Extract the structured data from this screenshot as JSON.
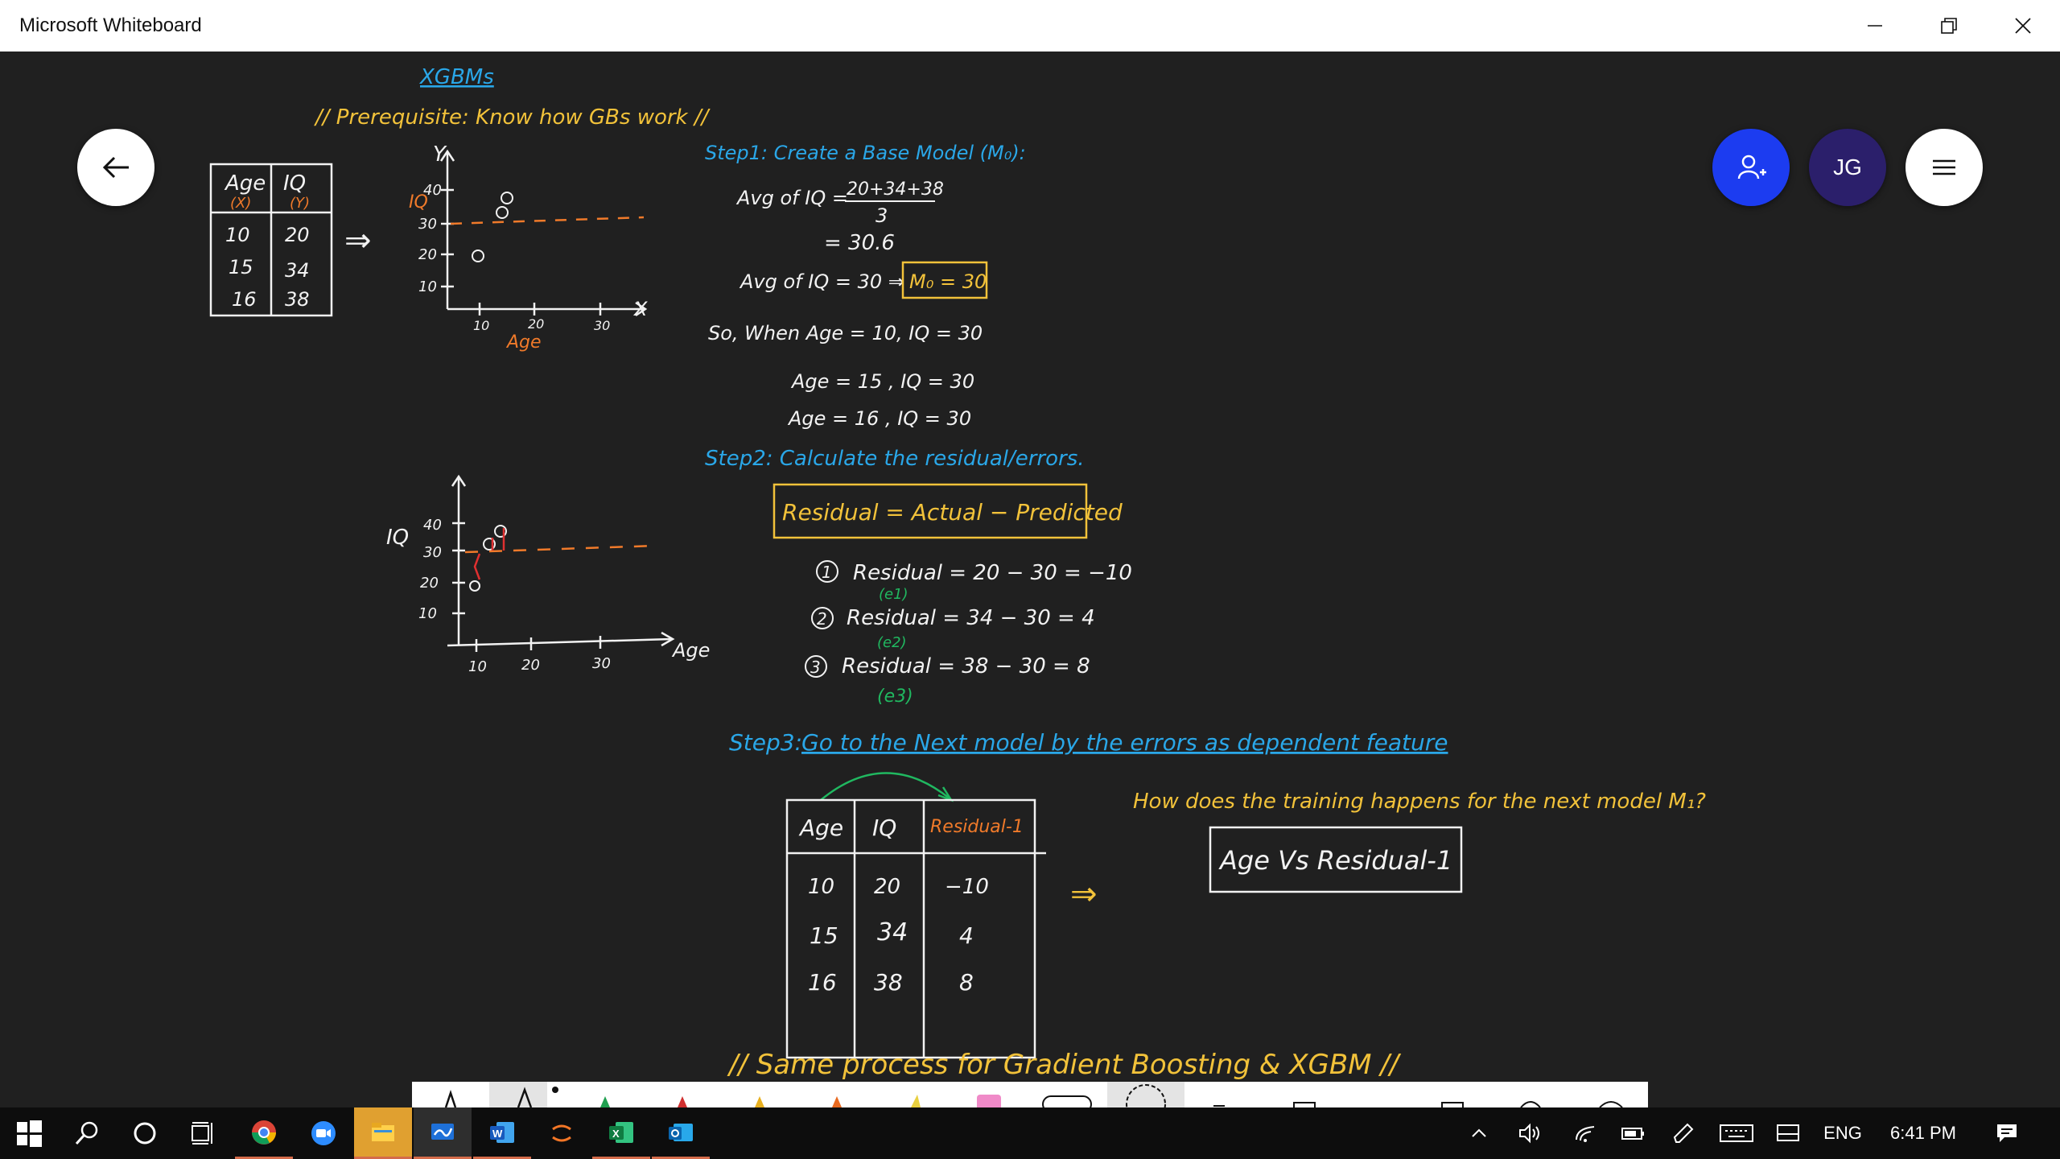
{
  "window": {
    "title": "Microsoft Whiteboard",
    "controls": [
      "minimize-icon",
      "restore-icon",
      "close-icon"
    ]
  },
  "canvas": {
    "heading": "XGBMs",
    "prerequisite": "// Prerequisite: Know how GBs work //",
    "table1": {
      "headers": [
        "Age",
        "IQ"
      ],
      "subheaders": [
        "(X)",
        "(Y)"
      ],
      "rows": [
        [
          "10",
          "20"
        ],
        [
          "15",
          "34"
        ],
        [
          "16",
          "38"
        ]
      ]
    },
    "arrow": "⇒",
    "plot1": {
      "ylabel": "IQ",
      "yaxis": "Y",
      "xaxis": "X",
      "xlabel": "Age",
      "yticks": [
        "40",
        "30",
        "20",
        "10"
      ],
      "xticks": [
        "10",
        "20",
        "30"
      ]
    },
    "plot2": {
      "ylabel": "IQ",
      "xlabel": "Age",
      "yticks": [
        "40",
        "30",
        "20",
        "10"
      ],
      "xticks": [
        "10",
        "20",
        "30"
      ]
    },
    "step1": {
      "title": "Step1: Create a Base Model (M₀):",
      "line1": "Avg of IQ =",
      "fraction_num": "20+34+38",
      "fraction_den": "3",
      "line2": "= 30.6",
      "line3": "Avg of IQ = 30 ⇒",
      "boxed": "M₀ = 30",
      "line4": "So, When Age = 10, IQ = 30",
      "line5": "Age = 15 , IQ = 30",
      "line6": "Age = 16 , IQ = 30"
    },
    "step2": {
      "title": "Step2: Calculate the residual/errors.",
      "formula": "Residual = Actual − Predicted",
      "rows": [
        {
          "num": "1",
          "expr": "Residual = 20 − 30 = −10",
          "tag": "(e1)"
        },
        {
          "num": "2",
          "expr": "Residual = 34 − 30 = 4",
          "tag": "(e2)"
        },
        {
          "num": "3",
          "expr": "Residual = 38 − 30 = 8",
          "tag": "(e3)"
        }
      ]
    },
    "step3": {
      "label": "Step3:",
      "text": "Go to the Next model by the errors as dependent feature"
    },
    "table2": {
      "headers": [
        "Age",
        "IQ",
        "Residual-1"
      ],
      "rows": [
        [
          "10",
          "20",
          "−10"
        ],
        [
          "15",
          "34",
          "4"
        ],
        [
          "16",
          "38",
          "8"
        ]
      ]
    },
    "question": "How does the training happens for the next model M₁?",
    "answer_box": "Age Vs Residual-1",
    "footer_note": "// Same process for Gradient Boosting & XGBM //"
  },
  "buttons": {
    "back": "back-arrow-icon",
    "invite": "add-person-icon",
    "avatar": "JG",
    "menu": "hamburger-menu-icon"
  },
  "colors": {
    "ink_white": "#f2f2f2",
    "ink_yellow": "#f2c23a",
    "ink_orange": "#f07a2a",
    "ink_blue": "#2aa7e8",
    "ink_green": "#20b860",
    "ink_red": "#e03030",
    "invite_blue": "#1c3cf0",
    "avatar_purple": "#2b1f6b",
    "taskbar": "#0d0d0d"
  },
  "taskbar": {
    "apps": [
      "windows-start-icon",
      "search-icon",
      "cortana-icon",
      "task-view-icon",
      "chrome-icon",
      "zoom-icon",
      "file-explorer-icon",
      "whiteboard-icon",
      "word-icon",
      "jupyter-icon",
      "excel-icon",
      "outlook-icon"
    ],
    "language": "ENG",
    "time": "6:41 PM"
  }
}
